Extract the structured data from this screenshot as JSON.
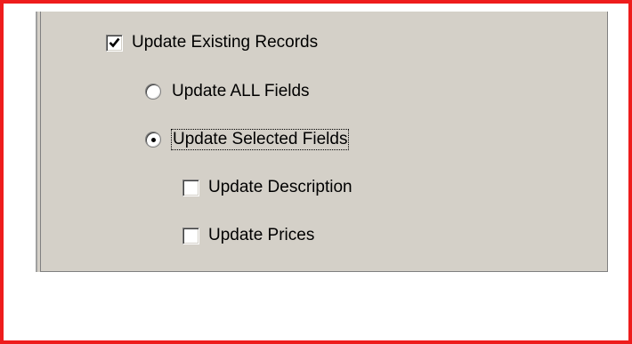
{
  "options": {
    "update_existing": {
      "label": "Update Existing Records",
      "checked": true
    },
    "update_all": {
      "label": "Update ALL Fields",
      "selected": false
    },
    "update_selected": {
      "label": "Update Selected Fields",
      "selected": true,
      "focused": true
    },
    "update_description": {
      "label": "Update Description",
      "checked": false
    },
    "update_prices": {
      "label": "Update Prices",
      "checked": false
    }
  },
  "colors": {
    "highlight_border": "#ee1c1c",
    "panel_background": "#d4d0c8"
  }
}
